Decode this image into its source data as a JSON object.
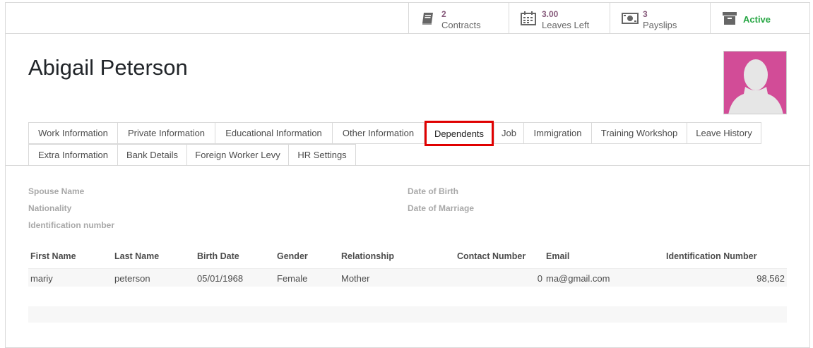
{
  "stats": {
    "contracts": {
      "value": "2",
      "label": "Contracts"
    },
    "leaves": {
      "value": "3.00",
      "label": "Leaves Left"
    },
    "payslips": {
      "value": "3",
      "label": "Payslips"
    },
    "active": {
      "label": "Active"
    }
  },
  "employee": {
    "name": "Abigail Peterson"
  },
  "tabs": [
    "Work Information",
    "Private Information",
    "Educational Information",
    "Other Information",
    "Dependents",
    "Job",
    "Immigration",
    "Training Workshop",
    "Leave History",
    "Extra Information",
    "Bank Details",
    "Foreign Worker Levy",
    "HR Settings"
  ],
  "fields": {
    "spouse_name": "Spouse Name",
    "nationality": "Nationality",
    "identification_number": "Identification number",
    "date_of_birth": "Date of Birth",
    "date_of_marriage": "Date of Marriage"
  },
  "dependents_table": {
    "columns": [
      "First Name",
      "Last Name",
      "Birth Date",
      "Gender",
      "Relationship",
      "Contact Number",
      "Email",
      "Identification Number"
    ],
    "rows": [
      [
        "mariy",
        "peterson",
        "05/01/1968",
        "Female",
        "Mother",
        "0",
        "ma@gmail.com",
        "98,562"
      ]
    ]
  },
  "colors": {
    "accent": "#875a7b",
    "active": "#28a745",
    "highlight": "#e00000",
    "avatar_bg": "#d24c97"
  }
}
